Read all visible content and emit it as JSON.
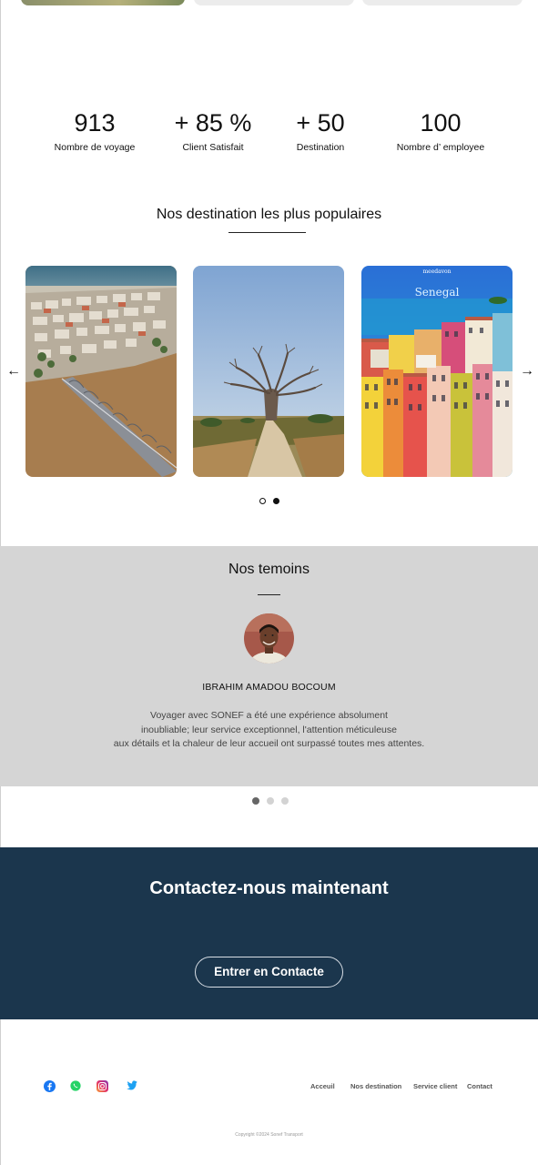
{
  "stats": [
    {
      "value": "913",
      "label": "Nombre de voyage"
    },
    {
      "value": "+ 85 %",
      "label": "Client Satisfait"
    },
    {
      "value": "+ 50",
      "label": "Destination"
    },
    {
      "value": "100",
      "label": "Nombre d’ employee"
    }
  ],
  "destinations": {
    "title": "Nos destination les plus populaires",
    "prev_arrow": "←",
    "next_arrow": "→",
    "cards": [
      {
        "image": "aerial-city-bridge-photo"
      },
      {
        "image": "baobab-tree-photo"
      },
      {
        "image": "colorful-houses-photo",
        "caption_top": "meedavon",
        "caption": "Senegal"
      }
    ],
    "pagination": {
      "count": 2,
      "active": 1
    }
  },
  "testimonials": {
    "title": "Nos temoins",
    "name": "IBRAHIM AMADOU BOCOUM",
    "text_lines": [
      "Voyager avec SONEF a été une expérience absolument",
      "inoubliable; leur service exceptionnel, l'attention méticuleuse",
      "aux détails et la chaleur de leur accueil ont surpassé toutes mes attentes."
    ],
    "pagination": {
      "count": 3,
      "active": 0
    }
  },
  "contact": {
    "title": "Contactez-nous maintenant",
    "button_label": "Entrer en Contacte"
  },
  "footer": {
    "social": [
      {
        "icon": "facebook-icon",
        "color": "#1877f2"
      },
      {
        "icon": "whatsapp-icon",
        "color": "#25d366"
      },
      {
        "icon": "instagram-icon",
        "color": "#d6249f"
      },
      {
        "icon": "twitter-icon",
        "color": "#1da1f2"
      }
    ],
    "links": [
      "Acceuil",
      "Nos destination",
      "Service client",
      "Contact"
    ],
    "copyright": "Copyright ©2024 Sonef Transport"
  },
  "colors": {
    "contact_bg": "#1b364d",
    "testimonials_bg": "#d5d5d5",
    "active_dot": "#111111"
  }
}
